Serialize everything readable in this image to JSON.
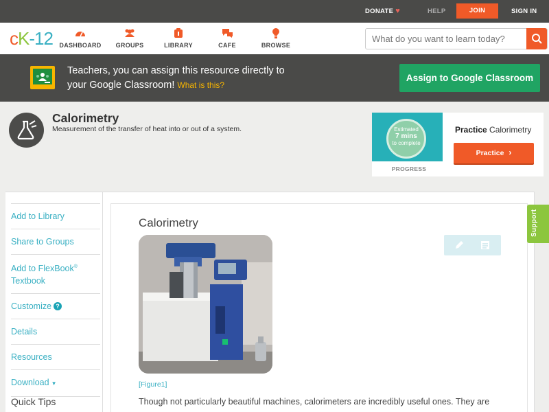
{
  "topbar": {
    "donate": "DONATE",
    "help": "HELP",
    "join": "JOIN",
    "signin": "SIGN IN"
  },
  "logo": {
    "part1": "c",
    "part2": "K",
    "part3": "-12"
  },
  "nav": [
    {
      "label": "DASHBOARD",
      "icon": "dashboard-icon"
    },
    {
      "label": "GROUPS",
      "icon": "groups-icon"
    },
    {
      "label": "LIBRARY",
      "icon": "library-icon"
    },
    {
      "label": "CAFE",
      "icon": "cafe-icon"
    },
    {
      "label": "BROWSE",
      "icon": "browse-icon"
    }
  ],
  "search": {
    "placeholder": "What do you want to learn today?"
  },
  "classroom": {
    "line1": "Teachers, you can assign this resource directly to",
    "line2": "your Google Classroom!",
    "what": "What is this?",
    "button": "Assign to Google Classroom"
  },
  "concept": {
    "title": "Calorimetry",
    "subtitle": "Measurement of the transfer of heat into or out of a system."
  },
  "practice": {
    "estimated": "Estimated",
    "mins": "7 mins",
    "complete": "to complete",
    "progress": "PROGRESS",
    "title_bold": "Practice",
    "title_rest": "Calorimetry",
    "button": "Practice"
  },
  "sidebar": {
    "items": [
      {
        "label": "Add to Library"
      },
      {
        "label": "Share to Groups"
      },
      {
        "label": "Add to FlexBook",
        "sup": "®",
        "label2": "Textbook"
      },
      {
        "label": "Customize"
      },
      {
        "label": "Details"
      },
      {
        "label": "Resources"
      },
      {
        "label": "Download"
      }
    ],
    "quick_tips": "Quick Tips"
  },
  "main": {
    "title": "Calorimetry",
    "figure": "[Figure1]",
    "paragraph": "Though not particularly beautiful machines, calorimeters are incredibly useful ones. They are"
  },
  "support": "Support",
  "colors": {
    "brand_orange": "#f05a28",
    "brand_green": "#8cc63e",
    "brand_teal": "#3ab0c3",
    "classroom_green": "#20a463",
    "dark_bar": "#4a4a48"
  }
}
